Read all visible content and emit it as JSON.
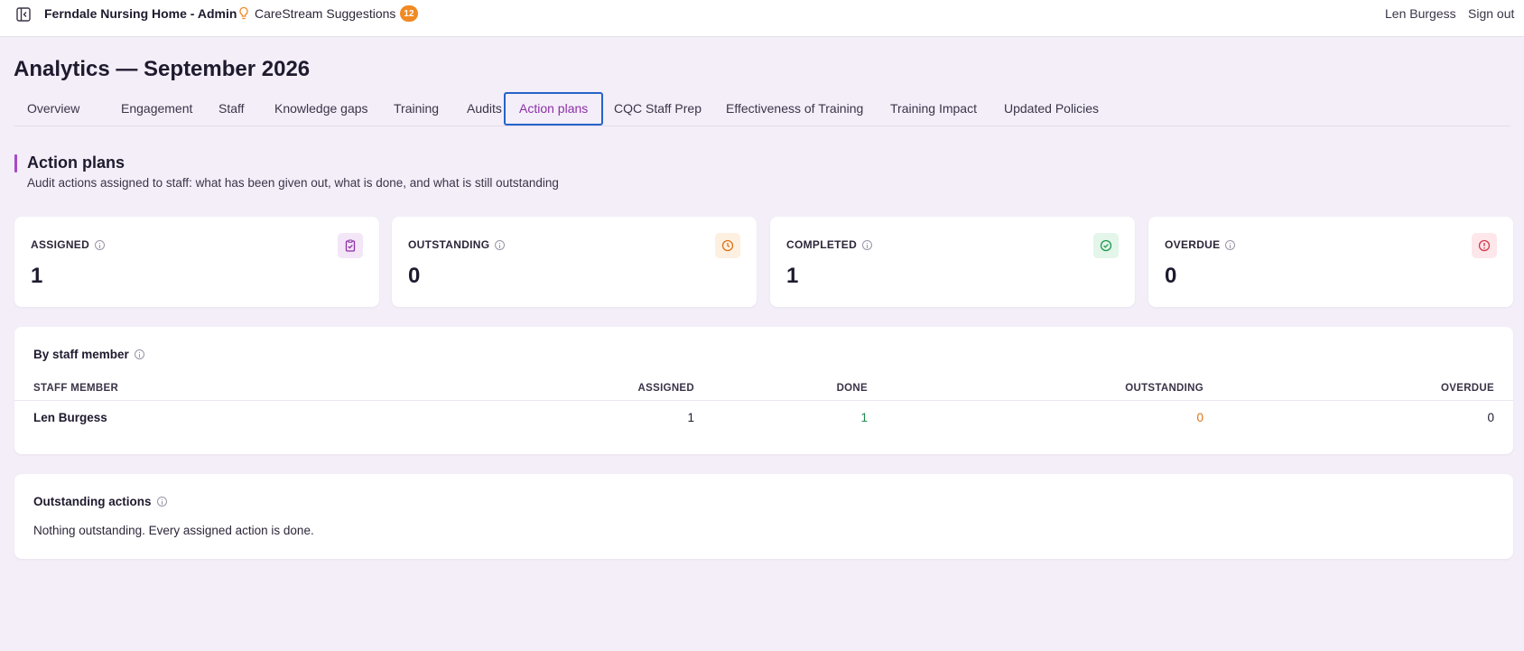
{
  "header": {
    "app_title": "Ferndale Nursing Home - Admin",
    "suggestions_label": "CareStream Suggestions",
    "suggestions_count": "12",
    "user_name": "Len Burgess",
    "signout_label": "Sign out"
  },
  "page": {
    "title": "Analytics — September 2026"
  },
  "tabs": [
    {
      "label": "Overview"
    },
    {
      "label": "Engagement"
    },
    {
      "label": "Staff"
    },
    {
      "label": "Knowledge gaps"
    },
    {
      "label": "Training"
    },
    {
      "label": "Audits"
    },
    {
      "label": "Action plans",
      "active": true
    },
    {
      "label": "CQC Staff Prep"
    },
    {
      "label": "Effectiveness of Training"
    },
    {
      "label": "Training Impact"
    },
    {
      "label": "Updated Policies"
    }
  ],
  "section": {
    "title": "Action plans",
    "subtitle": "Audit actions assigned to staff: what has been given out, what is done, and what is still outstanding"
  },
  "stats": [
    {
      "label": "ASSIGNED",
      "value": "1",
      "icon": "clipboard-check-icon",
      "color": "#8e2fa8",
      "bg": "#f3e6f7"
    },
    {
      "label": "OUTSTANDING",
      "value": "0",
      "icon": "clock-icon",
      "color": "#d9741a",
      "bg": "#fdf0e1"
    },
    {
      "label": "COMPLETED",
      "value": "1",
      "icon": "check-circle-icon",
      "color": "#1f9a4f",
      "bg": "#e4f5ea"
    },
    {
      "label": "OVERDUE",
      "value": "0",
      "icon": "alert-circle-icon",
      "color": "#d6394a",
      "bg": "#fde7ea"
    }
  ],
  "by_staff": {
    "title": "By staff member",
    "columns": [
      "STAFF MEMBER",
      "ASSIGNED",
      "DONE",
      "OUTSTANDING",
      "OVERDUE"
    ],
    "rows": [
      {
        "name": "Len Burgess",
        "assigned": "1",
        "done": "1",
        "outstanding": "0",
        "overdue": "0"
      }
    ]
  },
  "outstanding": {
    "title": "Outstanding actions",
    "message": "Nothing outstanding. Every assigned action is done."
  }
}
